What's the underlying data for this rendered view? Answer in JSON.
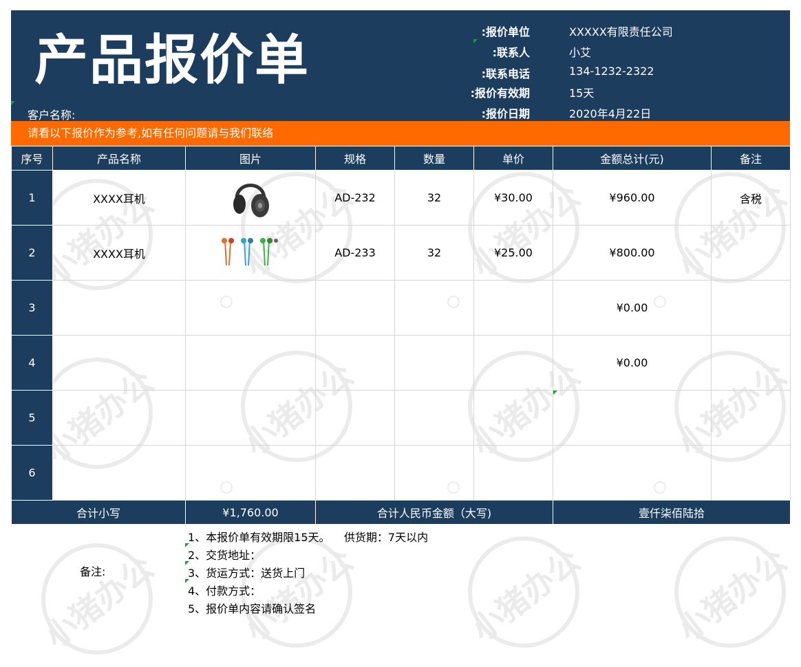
{
  "header": {
    "title": "产品报价单",
    "customer_label": "客户名称:",
    "info": [
      {
        "label": "报价单位:",
        "value": "XXXXX有限责任公司"
      },
      {
        "label": "联系人:",
        "value": "小艾"
      },
      {
        "label": "联系电话:",
        "value": "134-1232-2322"
      },
      {
        "label": "报价有效期:",
        "value": "15天"
      },
      {
        "label": "报价日期:",
        "value": "2020年4月22日"
      }
    ]
  },
  "notice": "请看以下报价作为参考,如有任何问题请与我们联络",
  "table": {
    "headers": [
      "序号",
      "产品名称",
      "图片",
      "规格",
      "数量",
      "单价",
      "金额总计(元)",
      "备注"
    ],
    "rows": [
      {
        "no": "1",
        "name": "XXXX耳机",
        "image_icon": "headphones-icon",
        "spec": "AD-232",
        "qty": "32",
        "price": "¥30.00",
        "total": "¥960.00",
        "remark": "含税"
      },
      {
        "no": "2",
        "name": "XXXX耳机",
        "image_icon": "earphones-icon",
        "spec": "AD-233",
        "qty": "32",
        "price": "¥25.00",
        "total": "¥800.00",
        "remark": ""
      },
      {
        "no": "3",
        "name": "",
        "image_icon": "",
        "spec": "",
        "qty": "",
        "price": "",
        "total": "¥0.00",
        "remark": ""
      },
      {
        "no": "4",
        "name": "",
        "image_icon": "",
        "spec": "",
        "qty": "",
        "price": "",
        "total": "¥0.00",
        "remark": ""
      },
      {
        "no": "5",
        "name": "",
        "image_icon": "",
        "spec": "",
        "qty": "",
        "price": "",
        "total": "",
        "remark": ""
      },
      {
        "no": "6",
        "name": "",
        "image_icon": "",
        "spec": "",
        "qty": "",
        "price": "",
        "total": "",
        "remark": ""
      }
    ],
    "footer": {
      "subtotal_label": "合计小写",
      "subtotal_value": "¥1,760.00",
      "rmb_label": "合计人民币金额（大写)",
      "rmb_value": "壹仟柒佰陆拾"
    }
  },
  "notes": {
    "label": "备注:",
    "lines": [
      "1、本报价单有效期限15天。    供货期：7天以内",
      "2、交货地址：",
      "3、货运方式：送货上门",
      "4、付款方式：",
      "5、报价单内容请确认签名"
    ]
  },
  "watermark": "小猪办公",
  "colors": {
    "header_bg": "#1c3d5e",
    "notice_bg": "#ff6a00"
  }
}
